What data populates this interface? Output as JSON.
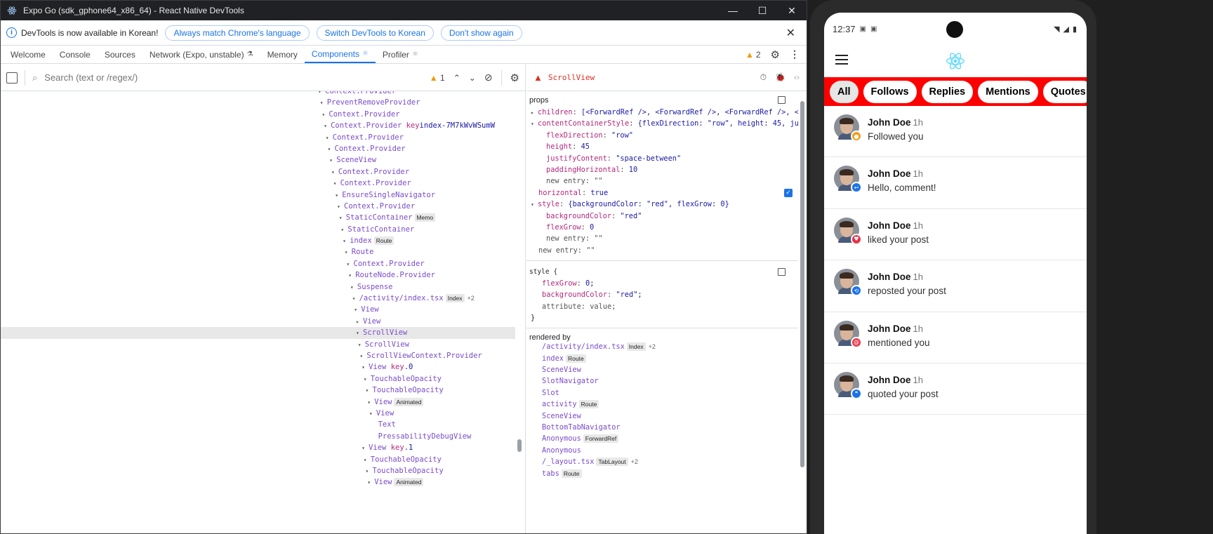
{
  "window": {
    "title": "Expo Go (sdk_gphone64_x86_64) - React Native DevTools",
    "minimize": "—",
    "maximize": "☐",
    "close": "✕"
  },
  "infobar": {
    "message": "DevTools is now available in Korean!",
    "btn_match": "Always match Chrome's language",
    "btn_switch": "Switch DevTools to Korean",
    "btn_dismiss": "Don't show again"
  },
  "tabs": [
    {
      "label": "Welcome"
    },
    {
      "label": "Console"
    },
    {
      "label": "Sources"
    },
    {
      "label": "Network (Expo, unstable)"
    },
    {
      "label": "Memory"
    },
    {
      "label": "Components"
    },
    {
      "label": "Profiler"
    }
  ],
  "warnings_count": "2",
  "search": {
    "placeholder": "Search (text or /regex/)",
    "warning_count": "1"
  },
  "tree": [
    {
      "label": "Context.Provider",
      "indent": 0
    },
    {
      "label": "PreventRemoveProvider",
      "indent": 1
    },
    {
      "label": "Context.Provider",
      "indent": 2
    },
    {
      "label": "Context.Provider",
      "indent": 3,
      "key": "index-7M7kWvWSumW"
    },
    {
      "label": "Context.Provider",
      "indent": 4
    },
    {
      "label": "Context.Provider",
      "indent": 5
    },
    {
      "label": "SceneView",
      "indent": 6
    },
    {
      "label": "Context.Provider",
      "indent": 7
    },
    {
      "label": "Context.Provider",
      "indent": 8
    },
    {
      "label": "EnsureSingleNavigator",
      "indent": 9
    },
    {
      "label": "Context.Provider",
      "indent": 10
    },
    {
      "label": "StaticContainer",
      "indent": 11,
      "badge": "Memo"
    },
    {
      "label": "StaticContainer",
      "indent": 12
    },
    {
      "label": "index",
      "indent": 13,
      "badge": "Route"
    },
    {
      "label": "Route",
      "indent": 14
    },
    {
      "label": "Context.Provider",
      "indent": 15
    },
    {
      "label": "RouteNode.Provider",
      "indent": 16
    },
    {
      "label": "Suspense",
      "indent": 17
    },
    {
      "label": "/activity/index.tsx",
      "indent": 18,
      "badge": "Index",
      "extra": "+2"
    },
    {
      "label": "View",
      "indent": 19
    },
    {
      "label": "View",
      "indent": 20,
      "collapsed": true
    },
    {
      "label": "ScrollView",
      "indent": 20,
      "selected": true
    },
    {
      "label": "ScrollView",
      "indent": 21
    },
    {
      "label": "ScrollViewContext.Provider",
      "indent": 22
    },
    {
      "label": "View",
      "indent": 23,
      "key": ".0"
    },
    {
      "label": "TouchableOpacity",
      "indent": 24
    },
    {
      "label": "TouchableOpacity",
      "indent": 25
    },
    {
      "label": "View",
      "indent": 26,
      "badge": "Animated"
    },
    {
      "label": "View",
      "indent": 27
    },
    {
      "label": "Text",
      "indent": 28,
      "leaf": true
    },
    {
      "label": "PressabilityDebugView",
      "indent": 28,
      "leaf": true
    },
    {
      "label": "View",
      "indent": 23,
      "key": ".1"
    },
    {
      "label": "TouchableOpacity",
      "indent": 24
    },
    {
      "label": "TouchableOpacity",
      "indent": 25
    },
    {
      "label": "View",
      "indent": 26,
      "badge": "Animated"
    }
  ],
  "props_panel": {
    "component": "ScrollView",
    "props_title": "props",
    "style_title": "style {",
    "style_close": "}",
    "rendered_by_title": "rendered by",
    "props": [
      {
        "level": 0,
        "arrow": "▸",
        "key": "children",
        "value": "[<ForwardRef />, <ForwardRef />, <ForwardRef />, <F…]"
      },
      {
        "level": 0,
        "arrow": "▾",
        "key": "contentContainerStyle",
        "value": "{flexDirection: \"row\", height: 45, justif…"
      },
      {
        "level": 1,
        "key": "flexDirection",
        "value": "\"row\""
      },
      {
        "level": 1,
        "key": "height",
        "value": "45"
      },
      {
        "level": 1,
        "key": "justifyContent",
        "value": "\"space-between\""
      },
      {
        "level": 1,
        "key": "paddingHorizontal",
        "value": "10"
      },
      {
        "level": 1,
        "key": "new entry",
        "value": "\"\"",
        "placeholder": true
      },
      {
        "level": 0,
        "key": "horizontal",
        "value": "true",
        "checkbox": true
      },
      {
        "level": 0,
        "arrow": "▾",
        "key": "style",
        "value": "{backgroundColor: \"red\", flexGrow: 0}"
      },
      {
        "level": 1,
        "key": "backgroundColor",
        "value": "\"red\""
      },
      {
        "level": 1,
        "key": "flexGrow",
        "value": "0"
      },
      {
        "level": 1,
        "key": "new entry",
        "value": "\"\"",
        "placeholder": true
      },
      {
        "level": 0,
        "key": "new entry",
        "value": "\"\"",
        "placeholder": true
      }
    ],
    "style_entries": [
      {
        "key": "flexGrow",
        "value": "0;"
      },
      {
        "key": "backgroundColor",
        "value": "\"red\";"
      },
      {
        "key": "attribute",
        "value": "value;",
        "placeholder": true
      }
    ],
    "rendered_by": [
      {
        "label": "/activity/index.tsx",
        "badge": "Index",
        "extra": "+2"
      },
      {
        "label": "index",
        "badge": "Route"
      },
      {
        "label": "SceneView"
      },
      {
        "label": "SlotNavigator"
      },
      {
        "label": "Slot"
      },
      {
        "label": "activity",
        "badge": "Route"
      },
      {
        "label": "SceneView"
      },
      {
        "label": "BottomTabNavigator"
      },
      {
        "label": "Anonymous",
        "badge": "ForwardRef"
      },
      {
        "label": "Anonymous"
      },
      {
        "label": "/_layout.tsx",
        "badge": "TabLayout",
        "extra": "+2"
      },
      {
        "label": "tabs",
        "badge": "Route"
      }
    ]
  },
  "phone": {
    "time": "12:37",
    "filters": [
      "All",
      "Follows",
      "Replies",
      "Mentions",
      "Quotes"
    ],
    "active_filter": "All",
    "notifications": [
      {
        "name": "John Doe",
        "time": "1h",
        "message": "Followed you",
        "badge_color": "#f0a020",
        "badge_icon": "person-icon",
        "glyph": "●"
      },
      {
        "name": "John Doe",
        "time": "1h",
        "message": "Hello, comment!",
        "badge_color": "#1a73e8",
        "badge_icon": "reply-icon",
        "glyph": "↩"
      },
      {
        "name": "John Doe",
        "time": "1h",
        "message": "liked your post",
        "badge_color": "#e8334a",
        "badge_icon": "heart-icon",
        "glyph": "♥"
      },
      {
        "name": "John Doe",
        "time": "1h",
        "message": "reposted your post",
        "badge_color": "#1a73e8",
        "badge_icon": "repost-icon",
        "glyph": "⟲"
      },
      {
        "name": "John Doe",
        "time": "1h",
        "message": "mentioned you",
        "badge_color": "#e8334a",
        "badge_icon": "at-icon",
        "glyph": "@"
      },
      {
        "name": "John Doe",
        "time": "1h",
        "message": "quoted your post",
        "badge_color": "#1a73e8",
        "badge_icon": "quote-icon",
        "glyph": "❝"
      }
    ]
  },
  "colors": {
    "accent": "#1a73e8",
    "filter_bar": "#ff0000",
    "selected_component": "#d93025"
  }
}
